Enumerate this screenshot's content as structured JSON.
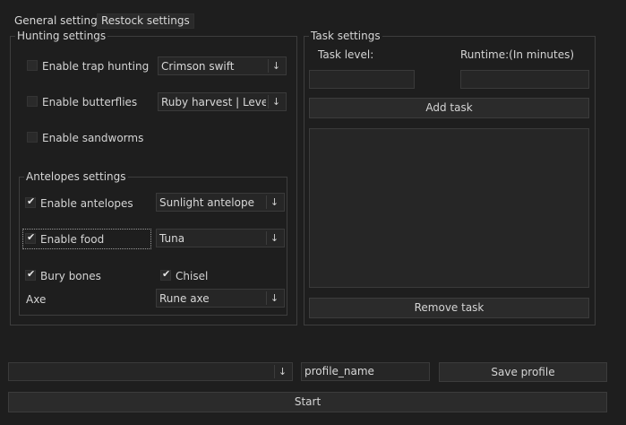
{
  "tabs": [
    {
      "label": "General settings"
    },
    {
      "label": "Restock settings"
    }
  ],
  "hunting": {
    "title": "Hunting settings",
    "trap": {
      "label": "Enable trap hunting",
      "selected": "Crimson swift"
    },
    "butterflies": {
      "label": "Enable butterflies",
      "selected": "Ruby harvest | Level:..."
    },
    "sandworms": {
      "label": "Enable sandworms"
    }
  },
  "antelopes": {
    "title": "Antelopes settings",
    "antelopes": {
      "label": "Enable antelopes",
      "selected": "Sunlight antelope",
      "checked": true
    },
    "food": {
      "label": "Enable food",
      "selected": "Tuna",
      "checked": true
    },
    "bury": {
      "label": "Bury bones",
      "checked": true
    },
    "chisel": {
      "label": "Chisel",
      "checked": true
    },
    "axe": {
      "label": "Axe",
      "selected": "Rune axe"
    }
  },
  "task": {
    "title": "Task settings",
    "level_label": "Task level:",
    "runtime_label": "Runtime:(In minutes)",
    "level_value": "",
    "runtime_value": "",
    "add_label": "Add task",
    "remove_label": "Remove task"
  },
  "profile": {
    "selected": "",
    "name_value": "profile_name",
    "save_label": "Save profile"
  },
  "start_label": "Start",
  "icons": {
    "arrow": "↓"
  }
}
